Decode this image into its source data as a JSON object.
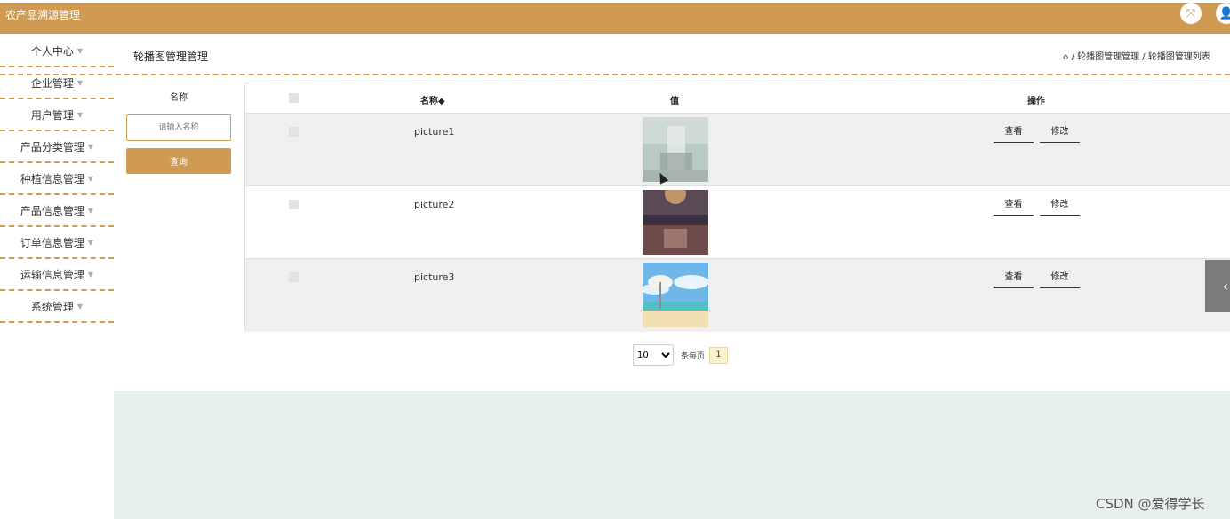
{
  "app": {
    "title": "农产品溯源管理"
  },
  "sidebar": {
    "items": [
      {
        "label": "个人中心"
      },
      {
        "label": "企业管理"
      },
      {
        "label": "用户管理"
      },
      {
        "label": "产品分类管理"
      },
      {
        "label": "种植信息管理"
      },
      {
        "label": "产品信息管理"
      },
      {
        "label": "订单信息管理"
      },
      {
        "label": "运输信息管理"
      },
      {
        "label": "系统管理"
      }
    ]
  },
  "header": {
    "title": "轮播图管理管理",
    "breadcrumb": "/ 轮播图管理管理 / 轮播图管理列表"
  },
  "search": {
    "label": "名称",
    "placeholder": "请输入名称",
    "button_label": "查询"
  },
  "table": {
    "columns": [
      "名称◆",
      "值",
      "操作"
    ],
    "rows": [
      {
        "name": "picture1",
        "view": "查看",
        "edit": "修改"
      },
      {
        "name": "picture2",
        "view": "查看",
        "edit": "修改"
      },
      {
        "name": "picture3",
        "view": "查看",
        "edit": "修改"
      }
    ]
  },
  "pagination": {
    "page_size": "10",
    "per_page_label": "条每页",
    "current_page": "1"
  },
  "watermark": "CSDN @爱得学长",
  "colors": {
    "accent": "#cf9a51",
    "bottom_area": "#e8f0eb"
  }
}
